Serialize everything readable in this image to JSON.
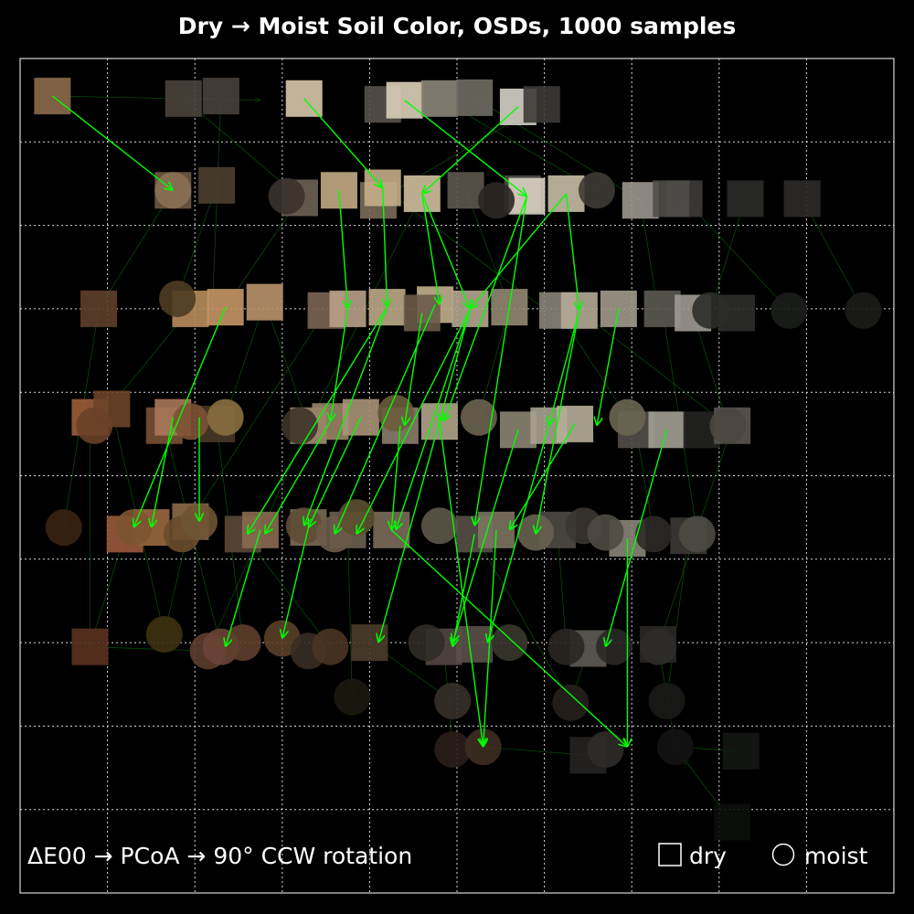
{
  "chart_data": {
    "type": "scatter",
    "title": "Dry → Moist Soil Color, OSDs, 1000 samples",
    "caption": "ΔE00 → PCoA → 90° CCW rotation",
    "legend": [
      {
        "symbol": "square",
        "label": "dry"
      },
      {
        "symbol": "circle",
        "label": "moist"
      }
    ],
    "legend_position": "bottom-right",
    "grid": true,
    "xlim": [
      0,
      10
    ],
    "ylim": [
      0,
      10
    ],
    "arrow_color": "#00ff00",
    "dry": [
      {
        "x": 0.37,
        "y": 9.55,
        "c": "#8c6a4c"
      },
      {
        "x": 1.87,
        "y": 9.52,
        "c": "#4a443c"
      },
      {
        "x": 2.3,
        "y": 9.55,
        "c": "#47433b"
      },
      {
        "x": 3.25,
        "y": 9.52,
        "c": "#d8c8aa"
      },
      {
        "x": 4.15,
        "y": 9.45,
        "c": "#57514b"
      },
      {
        "x": 4.4,
        "y": 9.5,
        "c": "#dcd0b8"
      },
      {
        "x": 4.8,
        "y": 9.52,
        "c": "#8a8577"
      },
      {
        "x": 5.2,
        "y": 9.53,
        "c": "#6f6c63"
      },
      {
        "x": 5.7,
        "y": 9.42,
        "c": "#d4d0c6"
      },
      {
        "x": 5.97,
        "y": 9.45,
        "c": "#3c3a36"
      },
      {
        "x": 1.75,
        "y": 8.42,
        "c": "#6f5a43"
      },
      {
        "x": 2.25,
        "y": 8.48,
        "c": "#4d3f30"
      },
      {
        "x": 3.2,
        "y": 8.33,
        "c": "#6e6254"
      },
      {
        "x": 3.65,
        "y": 8.42,
        "c": "#c4aa84"
      },
      {
        "x": 4.1,
        "y": 8.3,
        "c": "#7a6b58"
      },
      {
        "x": 4.15,
        "y": 8.45,
        "c": "#c4ae88"
      },
      {
        "x": 4.6,
        "y": 8.38,
        "c": "#d2c0a0"
      },
      {
        "x": 5.1,
        "y": 8.42,
        "c": "#5e574c"
      },
      {
        "x": 5.75,
        "y": 8.38,
        "c": "#504c48"
      },
      {
        "x": 5.8,
        "y": 8.35,
        "c": "#dad2c2"
      },
      {
        "x": 6.25,
        "y": 8.38,
        "c": "#c6bca4"
      },
      {
        "x": 7.1,
        "y": 8.3,
        "c": "#9a968c"
      },
      {
        "x": 7.6,
        "y": 8.32,
        "c": "#3e3c3a"
      },
      {
        "x": 7.45,
        "y": 8.32,
        "c": "#504e4a"
      },
      {
        "x": 8.3,
        "y": 8.32,
        "c": "#2a2a28"
      },
      {
        "x": 8.95,
        "y": 8.32,
        "c": "#2c2b29"
      },
      {
        "x": 0.9,
        "y": 7.0,
        "c": "#5e3f2a"
      },
      {
        "x": 1.95,
        "y": 7.0,
        "c": "#b88c5c"
      },
      {
        "x": 2.35,
        "y": 7.02,
        "c": "#c69666"
      },
      {
        "x": 2.8,
        "y": 7.08,
        "c": "#b8946a"
      },
      {
        "x": 3.5,
        "y": 6.98,
        "c": "#7c6454"
      },
      {
        "x": 3.75,
        "y": 7.0,
        "c": "#b8a088"
      },
      {
        "x": 4.2,
        "y": 7.02,
        "c": "#bca888"
      },
      {
        "x": 4.75,
        "y": 7.05,
        "c": "#c2b08e"
      },
      {
        "x": 4.6,
        "y": 6.95,
        "c": "#6a5a48"
      },
      {
        "x": 5.15,
        "y": 7.0,
        "c": "#b4a68e"
      },
      {
        "x": 5.6,
        "y": 7.02,
        "c": "#928872"
      },
      {
        "x": 6.15,
        "y": 6.98,
        "c": "#8a8478"
      },
      {
        "x": 6.4,
        "y": 6.98,
        "c": "#b4aa96"
      },
      {
        "x": 6.85,
        "y": 7.0,
        "c": "#a09a8a"
      },
      {
        "x": 7.35,
        "y": 7.0,
        "c": "#5c5852"
      },
      {
        "x": 7.7,
        "y": 6.95,
        "c": "#9e9a92"
      },
      {
        "x": 8.2,
        "y": 6.95,
        "c": "#2e2d2b"
      },
      {
        "x": 0.8,
        "y": 5.7,
        "c": "#9a5e3a"
      },
      {
        "x": 1.05,
        "y": 5.8,
        "c": "#6a4428"
      },
      {
        "x": 1.65,
        "y": 5.6,
        "c": "#7a5036"
      },
      {
        "x": 1.75,
        "y": 5.7,
        "c": "#a8785a"
      },
      {
        "x": 2.25,
        "y": 5.62,
        "c": "#4a3826"
      },
      {
        "x": 3.3,
        "y": 5.6,
        "c": "#a08a72"
      },
      {
        "x": 3.55,
        "y": 5.65,
        "c": "#9a8468"
      },
      {
        "x": 3.9,
        "y": 5.7,
        "c": "#a89478"
      },
      {
        "x": 4.35,
        "y": 5.6,
        "c": "#8a7c6c"
      },
      {
        "x": 4.8,
        "y": 5.65,
        "c": "#b0a488"
      },
      {
        "x": 5.7,
        "y": 5.55,
        "c": "#8a8472"
      },
      {
        "x": 6.05,
        "y": 5.6,
        "c": "#aaa290"
      },
      {
        "x": 6.35,
        "y": 5.62,
        "c": "#b6ae98"
      },
      {
        "x": 7.05,
        "y": 5.55,
        "c": "#524e48"
      },
      {
        "x": 7.4,
        "y": 5.55,
        "c": "#a29e94"
      },
      {
        "x": 7.8,
        "y": 5.55,
        "c": "#222220"
      },
      {
        "x": 8.15,
        "y": 5.6,
        "c": "#5a5652"
      },
      {
        "x": 1.2,
        "y": 4.3,
        "c": "#9a5a3c"
      },
      {
        "x": 1.5,
        "y": 4.38,
        "c": "#9a6840"
      },
      {
        "x": 1.95,
        "y": 4.45,
        "c": "#8a6a48"
      },
      {
        "x": 2.55,
        "y": 4.3,
        "c": "#5c4838"
      },
      {
        "x": 2.75,
        "y": 4.35,
        "c": "#8a6a50"
      },
      {
        "x": 3.3,
        "y": 4.38,
        "c": "#7a6a52"
      },
      {
        "x": 3.75,
        "y": 4.35,
        "c": "#6c6050"
      },
      {
        "x": 4.25,
        "y": 4.35,
        "c": "#7a6c58"
      },
      {
        "x": 5.2,
        "y": 4.3,
        "c": "#565048"
      },
      {
        "x": 5.45,
        "y": 4.35,
        "c": "#7c7462"
      },
      {
        "x": 6.15,
        "y": 4.35,
        "c": "#4e4a42"
      },
      {
        "x": 6.95,
        "y": 4.25,
        "c": "#8a8478"
      },
      {
        "x": 7.65,
        "y": 4.28,
        "c": "#3a3834"
      },
      {
        "x": 0.8,
        "y": 2.95,
        "c": "#5a3220"
      },
      {
        "x": 4.0,
        "y": 3.0,
        "c": "#4a3c2a"
      },
      {
        "x": 4.85,
        "y": 2.95,
        "c": "#524640"
      },
      {
        "x": 5.2,
        "y": 2.98,
        "c": "#5a5048"
      },
      {
        "x": 6.5,
        "y": 2.93,
        "c": "#5e5a54"
      },
      {
        "x": 7.3,
        "y": 2.98,
        "c": "#2a2826"
      },
      {
        "x": 6.5,
        "y": 1.65,
        "c": "#262422"
      },
      {
        "x": 8.25,
        "y": 1.7,
        "c": "#141614"
      },
      {
        "x": 8.15,
        "y": 0.85,
        "c": "#0c0e0c"
      }
    ],
    "moist": [
      {
        "x": 1.75,
        "y": 8.42,
        "c": "#8a7054"
      },
      {
        "x": 3.05,
        "y": 8.35,
        "c": "#3a322c"
      },
      {
        "x": 5.45,
        "y": 8.3,
        "c": "#2c2824"
      },
      {
        "x": 6.6,
        "y": 8.42,
        "c": "#3e3a34"
      },
      {
        "x": 1.8,
        "y": 7.12,
        "c": "#4e3c22"
      },
      {
        "x": 8.8,
        "y": 6.98,
        "c": "#1c1e1c"
      },
      {
        "x": 9.65,
        "y": 6.98,
        "c": "#1c1c1a"
      },
      {
        "x": 7.9,
        "y": 6.98,
        "c": "#2c2c2a"
      },
      {
        "x": 0.85,
        "y": 5.6,
        "c": "#6a4028"
      },
      {
        "x": 1.95,
        "y": 5.65,
        "c": "#7c5234"
      },
      {
        "x": 2.35,
        "y": 5.7,
        "c": "#8a6e40"
      },
      {
        "x": 4.3,
        "y": 5.75,
        "c": "#6c5c3c"
      },
      {
        "x": 5.25,
        "y": 5.7,
        "c": "#6c6450"
      },
      {
        "x": 6.95,
        "y": 5.7,
        "c": "#6c6652"
      },
      {
        "x": 8.1,
        "y": 5.6,
        "c": "#4a4640"
      },
      {
        "x": 3.2,
        "y": 5.6,
        "c": "#3e3428"
      },
      {
        "x": 0.5,
        "y": 4.38,
        "c": "#3a2412"
      },
      {
        "x": 1.3,
        "y": 4.38,
        "c": "#7c5430"
      },
      {
        "x": 1.85,
        "y": 4.3,
        "c": "#6a4c2e"
      },
      {
        "x": 2.05,
        "y": 4.45,
        "c": "#6e5432"
      },
      {
        "x": 3.25,
        "y": 4.4,
        "c": "#5e4e34"
      },
      {
        "x": 3.6,
        "y": 4.3,
        "c": "#6a5a48"
      },
      {
        "x": 3.85,
        "y": 4.5,
        "c": "#5c5030"
      },
      {
        "x": 4.8,
        "y": 4.4,
        "c": "#5e5848"
      },
      {
        "x": 5.9,
        "y": 4.32,
        "c": "#686250"
      },
      {
        "x": 6.45,
        "y": 4.4,
        "c": "#3a3630"
      },
      {
        "x": 6.7,
        "y": 4.32,
        "c": "#4e4a42"
      },
      {
        "x": 7.25,
        "y": 4.3,
        "c": "#2c2a26"
      },
      {
        "x": 7.75,
        "y": 4.3,
        "c": "#4c4a44"
      },
      {
        "x": 1.65,
        "y": 3.1,
        "c": "#3e3210"
      },
      {
        "x": 2.15,
        "y": 2.9,
        "c": "#5c3e2e"
      },
      {
        "x": 2.3,
        "y": 2.95,
        "c": "#6a4436"
      },
      {
        "x": 2.55,
        "y": 3.0,
        "c": "#5e3e2c"
      },
      {
        "x": 3.0,
        "y": 3.05,
        "c": "#5a4028"
      },
      {
        "x": 3.3,
        "y": 2.9,
        "c": "#3a2e24"
      },
      {
        "x": 3.55,
        "y": 2.95,
        "c": "#4a3424"
      },
      {
        "x": 4.65,
        "y": 3.0,
        "c": "#302c28"
      },
      {
        "x": 5.6,
        "y": 3.0,
        "c": "#3a362c"
      },
      {
        "x": 6.25,
        "y": 2.95,
        "c": "#2a2622"
      },
      {
        "x": 6.8,
        "y": 2.95,
        "c": "#2a2826"
      },
      {
        "x": 7.3,
        "y": 2.95,
        "c": "#2e2c2a"
      },
      {
        "x": 3.8,
        "y": 2.35,
        "c": "#1c180e"
      },
      {
        "x": 4.95,
        "y": 2.3,
        "c": "#36302a"
      },
      {
        "x": 6.3,
        "y": 2.28,
        "c": "#26201c"
      },
      {
        "x": 7.4,
        "y": 2.3,
        "c": "#1a1a18"
      },
      {
        "x": 4.95,
        "y": 1.72,
        "c": "#2a1e18"
      },
      {
        "x": 5.3,
        "y": 1.75,
        "c": "#3e2e22"
      },
      {
        "x": 6.7,
        "y": 1.72,
        "c": "#2e2c28"
      },
      {
        "x": 7.5,
        "y": 1.75,
        "c": "#121312"
      }
    ],
    "arrows": [
      {
        "x1": 4.4,
        "y1": 9.5,
        "x2": 5.8,
        "y2": 8.35
      },
      {
        "x1": 5.7,
        "y1": 9.42,
        "x2": 4.6,
        "y2": 8.38
      },
      {
        "x1": 3.25,
        "y1": 9.52,
        "x2": 4.15,
        "y2": 8.45
      },
      {
        "x1": 0.37,
        "y1": 9.55,
        "x2": 1.75,
        "y2": 8.42
      },
      {
        "x1": 4.6,
        "y1": 8.38,
        "x2": 4.8,
        "y2": 7.05
      },
      {
        "x1": 4.6,
        "y1": 8.38,
        "x2": 5.15,
        "y2": 7.0
      },
      {
        "x1": 5.8,
        "y1": 8.35,
        "x2": 4.85,
        "y2": 5.65
      },
      {
        "x1": 5.8,
        "y1": 8.35,
        "x2": 5.2,
        "y2": 4.4
      },
      {
        "x1": 6.25,
        "y1": 8.38,
        "x2": 6.4,
        "y2": 6.98
      },
      {
        "x1": 6.25,
        "y1": 8.38,
        "x2": 5.15,
        "y2": 7.0
      },
      {
        "x1": 3.65,
        "y1": 8.42,
        "x2": 3.75,
        "y2": 7.0
      },
      {
        "x1": 4.15,
        "y1": 8.45,
        "x2": 4.2,
        "y2": 7.02
      },
      {
        "x1": 2.35,
        "y1": 7.02,
        "x2": 1.3,
        "y2": 4.38
      },
      {
        "x1": 4.2,
        "y1": 7.02,
        "x2": 2.6,
        "y2": 4.3
      },
      {
        "x1": 4.2,
        "y1": 7.02,
        "x2": 3.25,
        "y2": 4.4
      },
      {
        "x1": 4.75,
        "y1": 7.05,
        "x2": 3.6,
        "y2": 4.3
      },
      {
        "x1": 5.15,
        "y1": 7.0,
        "x2": 3.85,
        "y2": 4.3
      },
      {
        "x1": 5.15,
        "y1": 7.0,
        "x2": 4.3,
        "y2": 4.35
      },
      {
        "x1": 5.15,
        "y1": 7.0,
        "x2": 4.8,
        "y2": 5.65
      },
      {
        "x1": 6.4,
        "y1": 6.98,
        "x2": 6.05,
        "y2": 5.6
      },
      {
        "x1": 6.4,
        "y1": 6.98,
        "x2": 5.9,
        "y2": 4.3
      },
      {
        "x1": 6.85,
        "y1": 7.0,
        "x2": 6.6,
        "y2": 5.6
      },
      {
        "x1": 3.75,
        "y1": 7.0,
        "x2": 3.55,
        "y2": 5.65
      },
      {
        "x1": 4.6,
        "y1": 6.95,
        "x2": 4.4,
        "y2": 5.6
      },
      {
        "x1": 3.55,
        "y1": 5.65,
        "x2": 2.8,
        "y2": 4.3
      },
      {
        "x1": 3.9,
        "y1": 5.7,
        "x2": 3.3,
        "y2": 4.38
      },
      {
        "x1": 4.8,
        "y1": 5.65,
        "x2": 4.1,
        "y2": 3.0
      },
      {
        "x1": 4.35,
        "y1": 5.6,
        "x2": 4.25,
        "y2": 4.35
      },
      {
        "x1": 5.7,
        "y1": 5.55,
        "x2": 4.95,
        "y2": 3.0
      },
      {
        "x1": 6.05,
        "y1": 5.6,
        "x2": 5.35,
        "y2": 3.0
      },
      {
        "x1": 6.35,
        "y1": 5.62,
        "x2": 5.6,
        "y2": 4.35
      },
      {
        "x1": 7.4,
        "y1": 5.55,
        "x2": 6.7,
        "y2": 2.95
      },
      {
        "x1": 5.45,
        "y1": 4.35,
        "x2": 5.3,
        "y2": 1.75
      },
      {
        "x1": 5.2,
        "y1": 4.3,
        "x2": 4.95,
        "y2": 2.95
      },
      {
        "x1": 6.95,
        "y1": 4.25,
        "x2": 6.95,
        "y2": 1.75
      },
      {
        "x1": 4.8,
        "y1": 5.65,
        "x2": 5.3,
        "y2": 1.75
      },
      {
        "x1": 4.25,
        "y1": 4.35,
        "x2": 6.95,
        "y2": 1.75
      },
      {
        "x1": 3.3,
        "y1": 4.38,
        "x2": 3.0,
        "y2": 3.05
      },
      {
        "x1": 2.75,
        "y1": 4.35,
        "x2": 2.35,
        "y2": 2.95
      },
      {
        "x1": 1.75,
        "y1": 5.7,
        "x2": 1.5,
        "y2": 4.38
      },
      {
        "x1": 2.05,
        "y1": 5.7,
        "x2": 2.05,
        "y2": 4.45
      }
    ],
    "faint_arrows": [
      {
        "x1": 1.87,
        "y1": 9.52,
        "x2": 3.2,
        "y2": 8.33
      },
      {
        "x1": 2.3,
        "y1": 9.55,
        "x2": 2.2,
        "y2": 7.0
      },
      {
        "x1": 5.2,
        "y1": 9.53,
        "x2": 7.1,
        "y2": 8.3
      },
      {
        "x1": 4.8,
        "y1": 9.52,
        "x2": 6.6,
        "y2": 8.42
      },
      {
        "x1": 0.37,
        "y1": 9.55,
        "x2": 2.75,
        "y2": 9.5
      },
      {
        "x1": 5.97,
        "y1": 9.45,
        "x2": 4.1,
        "y2": 8.3
      },
      {
        "x1": 7.6,
        "y1": 8.32,
        "x2": 8.8,
        "y2": 6.98
      },
      {
        "x1": 8.95,
        "y1": 8.32,
        "x2": 9.65,
        "y2": 6.98
      },
      {
        "x1": 8.3,
        "y1": 8.32,
        "x2": 7.9,
        "y2": 6.98
      },
      {
        "x1": 7.1,
        "y1": 8.3,
        "x2": 7.3,
        "y2": 6.98
      },
      {
        "x1": 3.2,
        "y1": 8.33,
        "x2": 2.35,
        "y2": 7.02
      },
      {
        "x1": 2.25,
        "y1": 8.48,
        "x2": 1.8,
        "y2": 7.12
      },
      {
        "x1": 1.75,
        "y1": 8.42,
        "x2": 0.9,
        "y2": 7.0
      },
      {
        "x1": 5.1,
        "y1": 8.42,
        "x2": 5.6,
        "y2": 7.02
      },
      {
        "x1": 0.9,
        "y1": 7.0,
        "x2": 0.5,
        "y2": 4.38
      },
      {
        "x1": 1.95,
        "y1": 7.0,
        "x2": 0.85,
        "y2": 5.6
      },
      {
        "x1": 2.8,
        "y1": 7.08,
        "x2": 2.35,
        "y2": 5.7
      },
      {
        "x1": 2.8,
        "y1": 7.08,
        "x2": 3.3,
        "y2": 5.6
      },
      {
        "x1": 3.5,
        "y1": 6.98,
        "x2": 1.85,
        "y2": 4.3
      },
      {
        "x1": 5.6,
        "y1": 7.02,
        "x2": 5.25,
        "y2": 5.7
      },
      {
        "x1": 6.15,
        "y1": 6.98,
        "x2": 6.95,
        "y2": 5.7
      },
      {
        "x1": 7.35,
        "y1": 7.0,
        "x2": 7.75,
        "y2": 4.3
      },
      {
        "x1": 7.7,
        "y1": 6.95,
        "x2": 8.1,
        "y2": 5.6
      },
      {
        "x1": 0.8,
        "y1": 5.7,
        "x2": 0.8,
        "y2": 2.95
      },
      {
        "x1": 1.05,
        "y1": 5.8,
        "x2": 1.65,
        "y2": 3.1
      },
      {
        "x1": 1.65,
        "y1": 5.6,
        "x2": 2.3,
        "y2": 2.95
      },
      {
        "x1": 2.25,
        "y1": 5.62,
        "x2": 2.55,
        "y2": 3.0
      },
      {
        "x1": 3.3,
        "y1": 5.6,
        "x2": 2.15,
        "y2": 2.9
      },
      {
        "x1": 7.05,
        "y1": 5.55,
        "x2": 7.25,
        "y2": 4.3
      },
      {
        "x1": 8.15,
        "y1": 5.6,
        "x2": 7.3,
        "y2": 2.95
      },
      {
        "x1": 1.2,
        "y1": 4.3,
        "x2": 0.8,
        "y2": 2.95
      },
      {
        "x1": 1.95,
        "y1": 4.45,
        "x2": 1.65,
        "y2": 3.1
      },
      {
        "x1": 2.55,
        "y1": 4.3,
        "x2": 3.55,
        "y2": 2.95
      },
      {
        "x1": 3.75,
        "y1": 4.35,
        "x2": 3.8,
        "y2": 2.35
      },
      {
        "x1": 6.15,
        "y1": 4.35,
        "x2": 6.25,
        "y2": 2.95
      },
      {
        "x1": 7.65,
        "y1": 4.28,
        "x2": 7.4,
        "y2": 2.3
      },
      {
        "x1": 4.0,
        "y1": 3.0,
        "x2": 4.95,
        "y2": 2.3
      },
      {
        "x1": 4.85,
        "y1": 2.95,
        "x2": 4.95,
        "y2": 1.72
      },
      {
        "x1": 6.5,
        "y1": 2.93,
        "x2": 6.3,
        "y2": 2.28
      },
      {
        "x1": 7.3,
        "y1": 2.98,
        "x2": 7.5,
        "y2": 1.75
      },
      {
        "x1": 0.8,
        "y1": 2.95,
        "x2": 2.15,
        "y2": 2.9
      },
      {
        "x1": 6.5,
        "y1": 1.65,
        "x2": 5.3,
        "y2": 1.75
      },
      {
        "x1": 8.25,
        "y1": 1.7,
        "x2": 7.5,
        "y2": 1.75
      },
      {
        "x1": 8.15,
        "y1": 0.85,
        "x2": 7.6,
        "y2": 1.6
      },
      {
        "x1": 6.4,
        "y1": 6.98,
        "x2": 8.1,
        "y2": 5.6
      },
      {
        "x1": 4.15,
        "y1": 8.45,
        "x2": 6.0,
        "y2": 7.0
      },
      {
        "x1": 4.6,
        "y1": 8.38,
        "x2": 3.3,
        "y2": 5.6
      },
      {
        "x1": 5.2,
        "y1": 4.3,
        "x2": 6.3,
        "y2": 2.28
      }
    ]
  }
}
